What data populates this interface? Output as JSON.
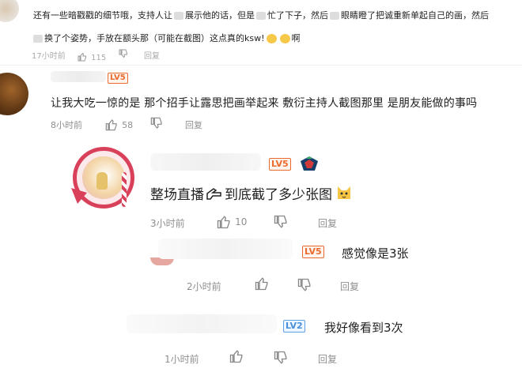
{
  "comments": [
    {
      "lines": [
        "还有一些暗戳戳的细节哦，支持人让",
        "展示他的话，但是",
        "忙了下子，然后",
        "眼睛瞪了把诚重新单起自己的画，然后",
        "换了个姿势，手放在额头那（可能在截图）这点真的ksw!",
        "啊"
      ],
      "time": "17小时前",
      "likes": "115",
      "reply": "回复"
    },
    {
      "level": "LV5",
      "text": "让我大吃一惊的是 那个招手让露思把画举起来 敷衍主持人截图那里 是朋友能做的事吗",
      "time": "8小时前",
      "likes": "58",
      "reply": "回复"
    },
    {
      "level": "LV5",
      "text_pre": "整场直播",
      "text_post": "到底截了多少张图",
      "time": "3小时前",
      "likes": "10",
      "reply": "回复"
    },
    {
      "level": "LV5",
      "text": "感觉像是3张",
      "time": "2小时前",
      "reply": "回复"
    },
    {
      "level": "LV2",
      "text": "我好像看到3次",
      "time": "1小时前",
      "reply": "回复"
    }
  ],
  "icons": {
    "like": "thumbs-up-icon",
    "dislike": "thumbs-down-icon",
    "sticker": "cat-emoji-icon",
    "badge": "level-badge-icon"
  },
  "colors": {
    "level_orange": "#ea6b2d",
    "level_blue": "#4a90d9",
    "meta_gray": "#8f8f8f"
  }
}
